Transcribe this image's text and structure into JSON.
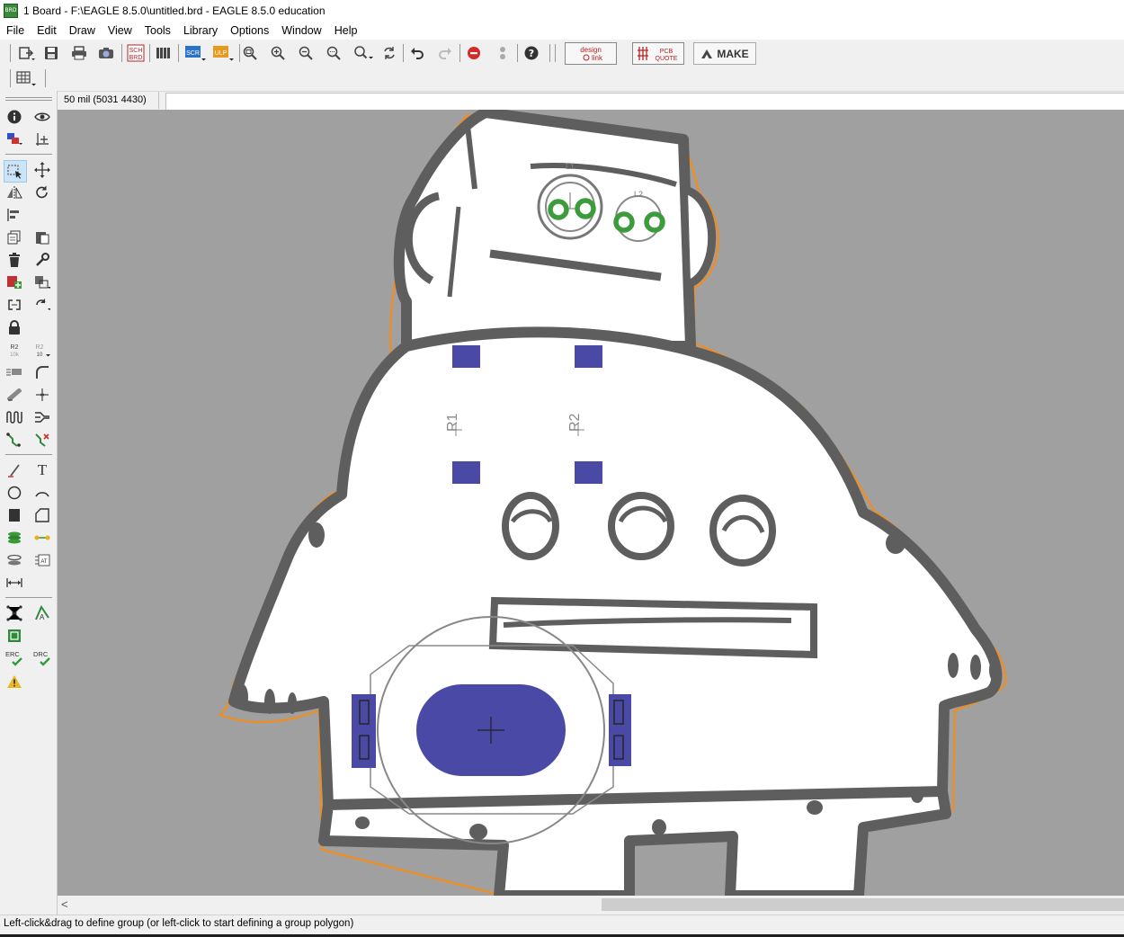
{
  "window": {
    "title": "1 Board - F:\\EAGLE 8.5.0\\untitled.brd - EAGLE 8.5.0 education",
    "app_icon": "eagle-brd-icon"
  },
  "menu": [
    "File",
    "Edit",
    "Draw",
    "View",
    "Tools",
    "Library",
    "Options",
    "Window",
    "Help"
  ],
  "toolbar": {
    "icons": [
      "open-icon",
      "save-icon",
      "print-icon",
      "cam-icon",
      "sch-brd-switch-icon",
      "library-icon",
      "script-icon",
      "ulp-icon",
      "zoom-fit-icon",
      "zoom-in-icon",
      "zoom-out-icon",
      "zoom-select-icon",
      "zoom-last-icon",
      "redraw-icon",
      "undo-icon",
      "redo-icon",
      "stop-icon",
      "go-icon",
      "help-icon"
    ],
    "sch_label": "SCH",
    "brd_label": "BRD",
    "scr_label": "SCR",
    "ulp_label": "ULP",
    "design_link_line1": "design",
    "design_link_line2": "link",
    "pcb_quote_line1": "PCB",
    "pcb_quote_line2": "QUOTE",
    "make_label": "MAKE",
    "grid_icon": "grid-icon"
  },
  "coords": {
    "display": "50 mil (5031 4430)"
  },
  "command_line": {
    "value": ""
  },
  "left_tools": [
    "info-icon",
    "show-icon",
    "display-layers-icon",
    "mark-icon",
    "group-icon",
    "move-icon",
    "mirror-icon",
    "rotate-icon",
    "align-icon",
    "copy-icon",
    "paste-icon",
    "delete-icon",
    "change-icon",
    "add-icon",
    "replace-icon",
    "swap-icon",
    "gate-swap-icon",
    "lock-icon",
    "name-icon",
    "value-icon",
    "smash-icon",
    "miter-icon",
    "split-icon",
    "optimize-icon",
    "meander-icon",
    "route-multiple-icon",
    "route-icon",
    "ripup-icon",
    "wire-icon",
    "text-icon",
    "circle-icon",
    "arc-icon",
    "rect-icon",
    "polygon-icon",
    "via-icon",
    "signal-icon",
    "hole-icon",
    "attribute-icon",
    "dimension-icon",
    "autorouter-icon",
    "fanout-icon",
    "ratsnest-icon",
    "erc-icon",
    "drc-icon",
    "errors-icon"
  ],
  "left_labels": {
    "r2_a": "R2",
    "r2_a_sub": "10k",
    "r2_b": "R2",
    "r2_b_sub": "10",
    "erc": "ERC",
    "drc": "DRC"
  },
  "board": {
    "parts": [
      "L1",
      "L2",
      "R1",
      "R2"
    ],
    "colors": {
      "background": "#a0a0a0",
      "outline": "#f28c1e",
      "silkscreen": "#5e5e5e",
      "fill": "#ffffff",
      "pad": "#4a4aa6",
      "via": "#3c9c3c"
    }
  },
  "status": {
    "text": "Left-click&drag to define group (or left-click to start defining a group polygon)"
  }
}
